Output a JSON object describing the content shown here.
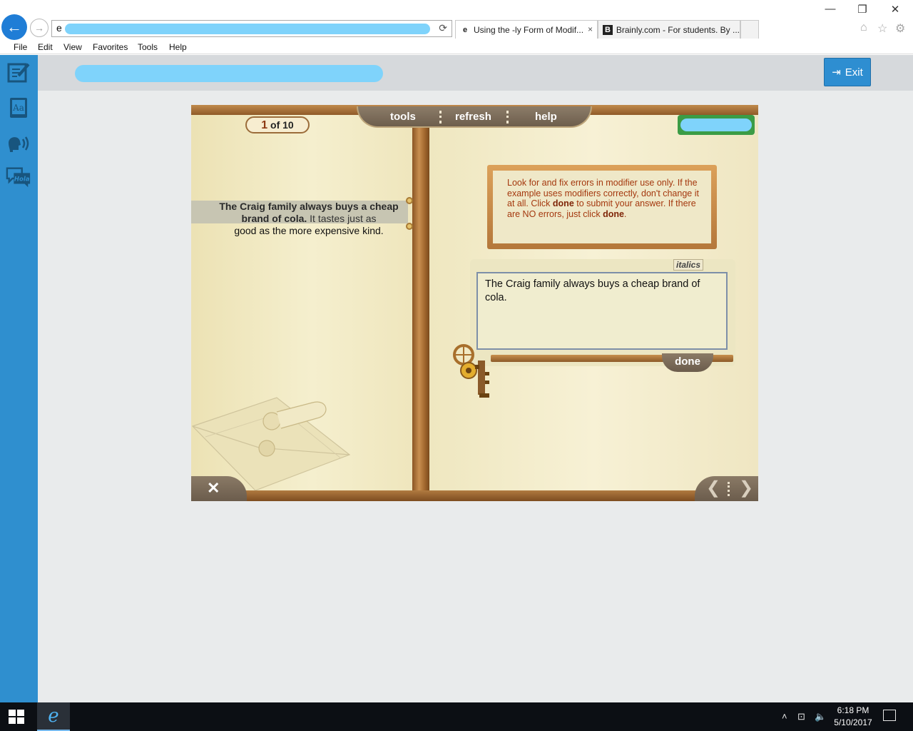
{
  "browser": {
    "address_prefix": "e",
    "refresh_icon": "refresh-icon",
    "tabs": [
      {
        "label": "Using the -ly Form of Modif...",
        "icon": "e",
        "close": "×"
      },
      {
        "label": "Brainly.com - For students. By ...",
        "icon": "B"
      }
    ],
    "window_controls": {
      "minimize": "—",
      "restore": "❐",
      "close": "✕"
    },
    "toolbar_icons": [
      "home-icon",
      "favorites-star-icon",
      "settings-gear-icon"
    ]
  },
  "menu": {
    "items": [
      "File",
      "Edit",
      "View",
      "Favorites",
      "Tools",
      "Help"
    ]
  },
  "app": {
    "exit_label": "Exit",
    "rail_icons": [
      "notepad-icon",
      "dictionary-icon",
      "text-to-speech-icon",
      "translate-icon"
    ],
    "translate_badge": "Hola"
  },
  "activity": {
    "counter": {
      "current": "1",
      "rest": "of 10"
    },
    "tools": [
      "tools",
      "refresh",
      "help"
    ],
    "passage": {
      "bold": "The Craig family always buys a cheap brand of cola.",
      "rest": " It tastes just as",
      "rest2": "good as the more expensive kind."
    },
    "instructions": {
      "part1": "Look for and fix errors in modifier use only. If the example uses modifiers correctly, don't change it at all. Click ",
      "done1": "done",
      "part2": " to submit your answer. If there are NO errors, just click ",
      "done2": "done",
      "part3": "."
    },
    "italics_label": "italics",
    "answer_value": "The Craig family always buys a cheap brand of cola.",
    "done_label": "done",
    "close_glyph": "✕",
    "prev_glyph": "❮",
    "next_glyph": "❯"
  },
  "taskbar": {
    "time": "6:18 PM",
    "date": "5/10/2017",
    "tray_icons": [
      "chevron-up-icon",
      "network-icon",
      "volume-icon",
      "notification-icon"
    ]
  },
  "colors": {
    "accent": "#2f8fcf",
    "instruction_text": "#a4380e",
    "wood": "#a56a30"
  }
}
